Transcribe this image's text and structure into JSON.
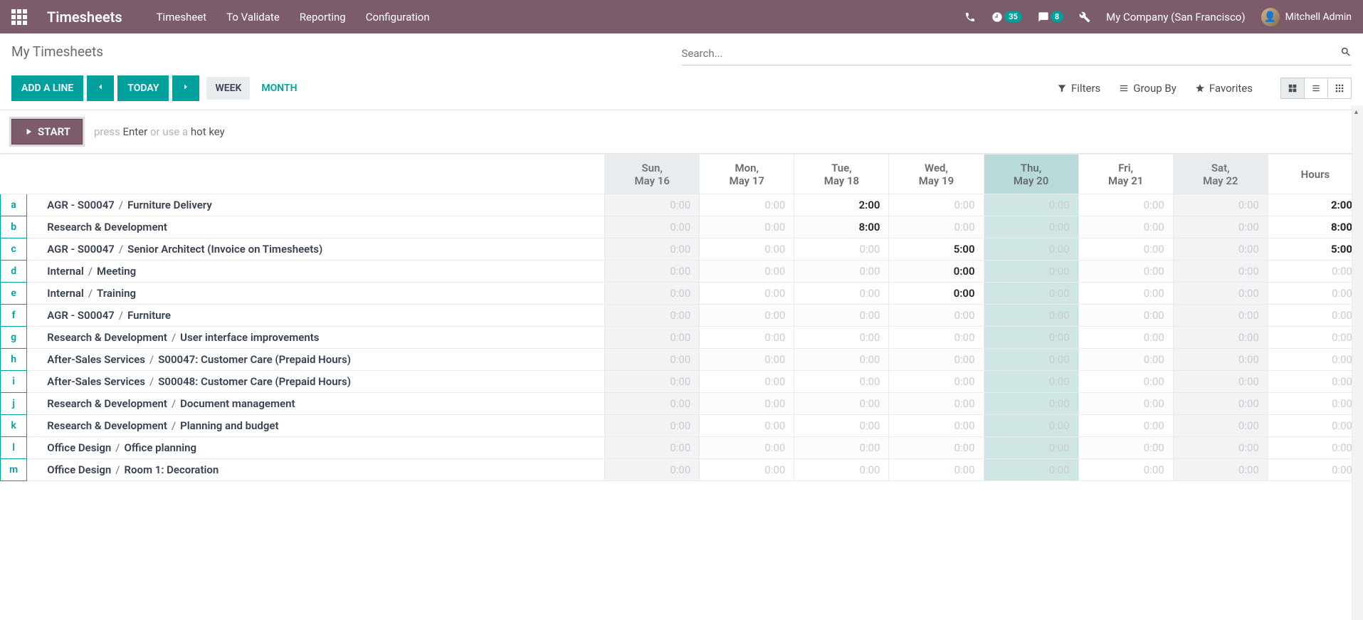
{
  "app": {
    "name": "Timesheets"
  },
  "nav": {
    "menu": [
      "Timesheet",
      "To Validate",
      "Reporting",
      "Configuration"
    ],
    "activity_count": "35",
    "msg_count": "8",
    "company": "My Company (San Francisco)",
    "user": "Mitchell Admin"
  },
  "breadcrumb": "My Timesheets",
  "search": {
    "placeholder": "Search..."
  },
  "buttons": {
    "add_line": "ADD A LINE",
    "today": "TODAY",
    "week": "WEEK",
    "month": "MONTH"
  },
  "opts": {
    "filters": "Filters",
    "groupby": "Group By",
    "favorites": "Favorites"
  },
  "start": {
    "btn": "START",
    "hint_pre": "press ",
    "hint_enter": "Enter",
    "hint_mid": " or use a ",
    "hint_hot": "hot key"
  },
  "columns": {
    "days": [
      {
        "top": "Sun,",
        "bot": "May 16",
        "class": "sunsat"
      },
      {
        "top": "Mon,",
        "bot": "May 17",
        "class": ""
      },
      {
        "top": "Tue,",
        "bot": "May 18",
        "class": ""
      },
      {
        "top": "Wed,",
        "bot": "May 19",
        "class": ""
      },
      {
        "top": "Thu,",
        "bot": "May 20",
        "class": "today"
      },
      {
        "top": "Fri,",
        "bot": "May 21",
        "class": ""
      },
      {
        "top": "Sat,",
        "bot": "May 22",
        "class": "sunsat"
      }
    ],
    "total": "Hours"
  },
  "rows": [
    {
      "hk": "a",
      "p1": "AGR - S00047",
      "p2": "Furniture Delivery",
      "cells": [
        "0:00",
        "0:00",
        "2:00",
        "0:00",
        "0:00",
        "0:00",
        "0:00"
      ],
      "total": "2:00"
    },
    {
      "hk": "b",
      "p1": "Research & Development",
      "p2": "",
      "cells": [
        "0:00",
        "0:00",
        "8:00",
        "0:00",
        "0:00",
        "0:00",
        "0:00"
      ],
      "total": "8:00"
    },
    {
      "hk": "c",
      "p1": "AGR - S00047",
      "p2": "Senior Architect (Invoice on Timesheets)",
      "cells": [
        "0:00",
        "0:00",
        "0:00",
        "5:00",
        "0:00",
        "0:00",
        "0:00"
      ],
      "total": "5:00"
    },
    {
      "hk": "d",
      "p1": "Internal",
      "p2": "Meeting",
      "cells": [
        "0:00",
        "0:00",
        "0:00",
        "0:00",
        "0:00",
        "0:00",
        "0:00"
      ],
      "total": "0:00",
      "nz": [
        3
      ]
    },
    {
      "hk": "e",
      "p1": "Internal",
      "p2": "Training",
      "cells": [
        "0:00",
        "0:00",
        "0:00",
        "0:00",
        "0:00",
        "0:00",
        "0:00"
      ],
      "total": "0:00",
      "nz": [
        3
      ]
    },
    {
      "hk": "f",
      "p1": "AGR - S00047",
      "p2": "Furniture",
      "cells": [
        "0:00",
        "0:00",
        "0:00",
        "0:00",
        "0:00",
        "0:00",
        "0:00"
      ],
      "total": "0:00"
    },
    {
      "hk": "g",
      "p1": "Research & Development",
      "p2": "User interface improvements",
      "cells": [
        "0:00",
        "0:00",
        "0:00",
        "0:00",
        "0:00",
        "0:00",
        "0:00"
      ],
      "total": "0:00"
    },
    {
      "hk": "h",
      "p1": "After-Sales Services",
      "p2": "S00047: Customer Care (Prepaid Hours)",
      "cells": [
        "0:00",
        "0:00",
        "0:00",
        "0:00",
        "0:00",
        "0:00",
        "0:00"
      ],
      "total": "0:00"
    },
    {
      "hk": "i",
      "p1": "After-Sales Services",
      "p2": "S00048: Customer Care (Prepaid Hours)",
      "cells": [
        "0:00",
        "0:00",
        "0:00",
        "0:00",
        "0:00",
        "0:00",
        "0:00"
      ],
      "total": "0:00"
    },
    {
      "hk": "j",
      "p1": "Research & Development",
      "p2": "Document management",
      "cells": [
        "0:00",
        "0:00",
        "0:00",
        "0:00",
        "0:00",
        "0:00",
        "0:00"
      ],
      "total": "0:00"
    },
    {
      "hk": "k",
      "p1": "Research & Development",
      "p2": "Planning and budget",
      "cells": [
        "0:00",
        "0:00",
        "0:00",
        "0:00",
        "0:00",
        "0:00",
        "0:00"
      ],
      "total": "0:00"
    },
    {
      "hk": "l",
      "p1": "Office Design",
      "p2": "Office planning",
      "cells": [
        "0:00",
        "0:00",
        "0:00",
        "0:00",
        "0:00",
        "0:00",
        "0:00"
      ],
      "total": "0:00"
    },
    {
      "hk": "m",
      "p1": "Office Design",
      "p2": "Room 1: Decoration",
      "cells": [
        "0:00",
        "0:00",
        "0:00",
        "0:00",
        "0:00",
        "0:00",
        "0:00"
      ],
      "total": "0:00"
    }
  ]
}
